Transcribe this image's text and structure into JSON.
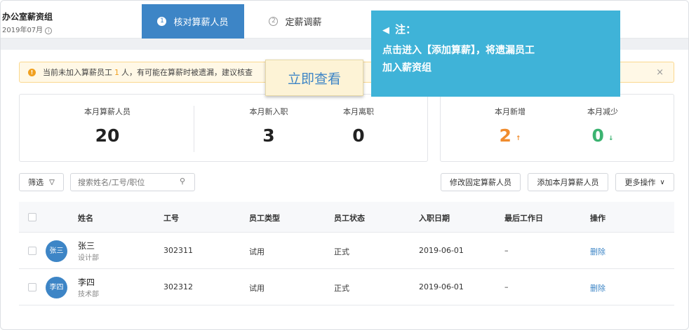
{
  "header": {
    "org_name": "办公室薪资组",
    "org_date": "2019年07月",
    "steps": [
      {
        "num": "1",
        "label": "核对算薪人员"
      },
      {
        "num": "2",
        "label": "定薪调薪"
      }
    ]
  },
  "alert": {
    "text_before": "当前未加入算薪员工",
    "count": "1",
    "text_after": "人，有可能在算薪时被遗漏，建议核查",
    "close": "×"
  },
  "stats": {
    "current_staff": {
      "label": "本月算薪人员",
      "value": "20"
    },
    "new_hires": {
      "label": "本月新入职",
      "value": "3"
    },
    "leavers": {
      "label": "本月离职",
      "value": "0"
    },
    "increase": {
      "label": "本月新增",
      "value": "2",
      "arrow": "↑"
    },
    "decrease": {
      "label": "本月减少",
      "value": "0",
      "arrow": "↓"
    }
  },
  "toolbar": {
    "filter_label": "筛选",
    "search_placeholder": "搜索姓名/工号/职位",
    "modify_label": "修改固定算薪人员",
    "add_label": "添加本月算薪人员",
    "more_label": "更多操作"
  },
  "table": {
    "columns": [
      "姓名",
      "工号",
      "员工类型",
      "员工状态",
      "入职日期",
      "最后工作日",
      "操作"
    ],
    "rows": [
      {
        "avatar": "张三",
        "name": "张三",
        "dept": "设计部",
        "id": "302311",
        "type": "试用",
        "status": "正式",
        "hire_date": "2019-06-01",
        "last_day": "–",
        "action": "删除"
      },
      {
        "avatar": "李四",
        "name": "李四",
        "dept": "技术部",
        "id": "302312",
        "type": "试用",
        "status": "正式",
        "hire_date": "2019-06-01",
        "last_day": "–",
        "action": "删除"
      }
    ]
  },
  "callouts": {
    "quick_view": "立即查看",
    "note_title": "注：",
    "note_body_1": "点击进入【添加算薪】，将遗漏员工",
    "note_body_2": "加入薪资组"
  },
  "colors": {
    "primary": "#3d85c6",
    "warning": "#f0a020",
    "increase": "#f08c2e",
    "decrease": "#3cb371",
    "note_bg": "#3fb3d8"
  }
}
